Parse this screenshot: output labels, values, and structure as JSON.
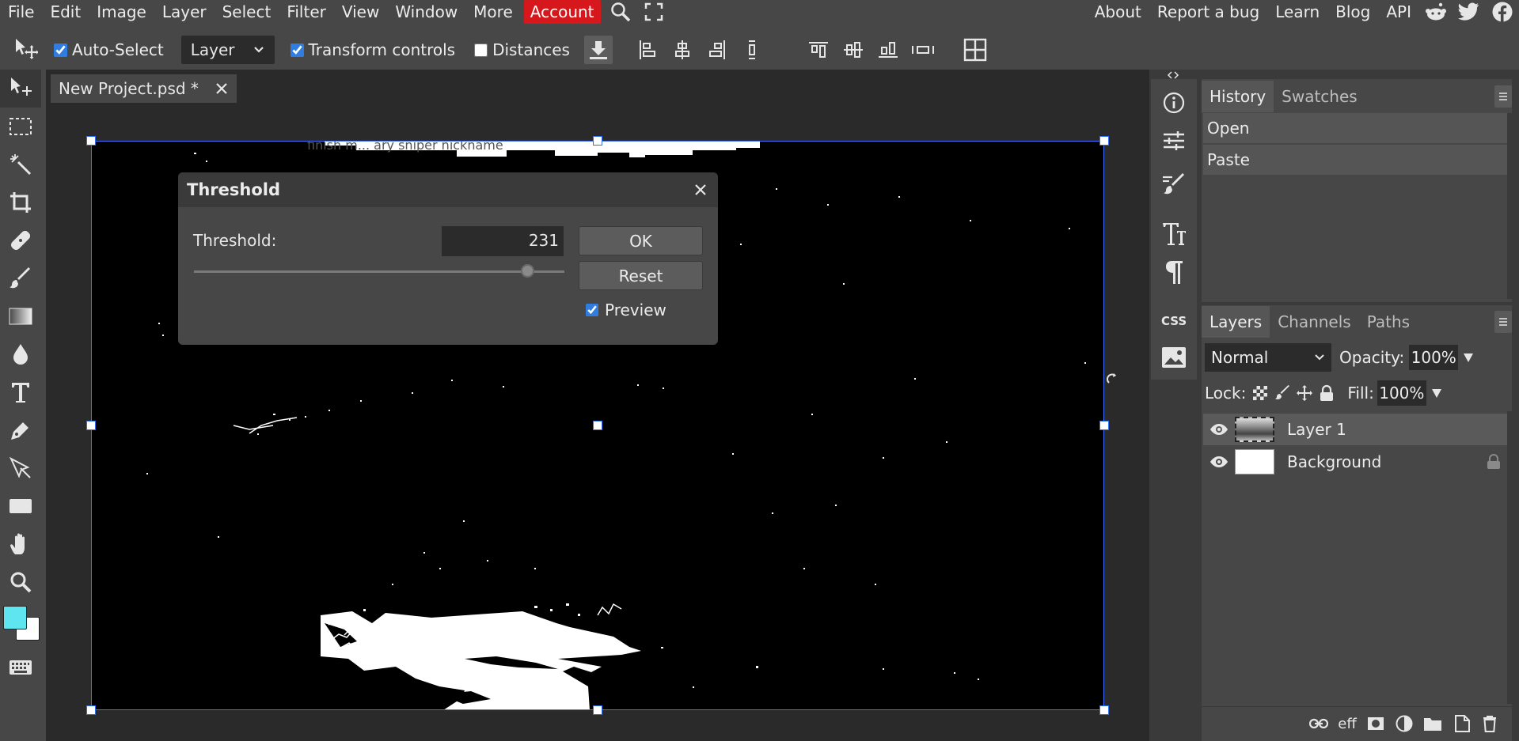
{
  "menu": {
    "items": [
      "File",
      "Edit",
      "Image",
      "Layer",
      "Select",
      "Filter",
      "View",
      "Window",
      "More"
    ],
    "account": "Account",
    "right_links": [
      "About",
      "Report a bug",
      "Learn",
      "Blog",
      "API"
    ],
    "social_icons": [
      "reddit-icon",
      "twitter-icon",
      "facebook-icon"
    ]
  },
  "toolbar": {
    "auto_select_label": "Auto-Select",
    "auto_select_checked": true,
    "target_select": "Layer",
    "transform_label": "Transform controls",
    "transform_checked": true,
    "distances_label": "Distances",
    "distances_checked": false
  },
  "document": {
    "tab_title": "New Project.psd *",
    "canvas_overlay_text": "finish m... ary sniper nickname"
  },
  "threshold_dialog": {
    "title": "Threshold",
    "label": "Threshold:",
    "value": "231",
    "slider_level": 0.9,
    "ok_label": "OK",
    "reset_label": "Reset",
    "preview_label": "Preview",
    "preview_checked": true
  },
  "history_panel": {
    "tabs": [
      "History",
      "Swatches"
    ],
    "active_tab": "History",
    "entries": [
      "Open",
      "Paste"
    ]
  },
  "layers_panel": {
    "tabs": [
      "Layers",
      "Channels",
      "Paths"
    ],
    "active_tab": "Layers",
    "blend_mode": "Normal",
    "opacity_label": "Opacity:",
    "opacity_value": "100%",
    "lock_label": "Lock:",
    "fill_label": "Fill:",
    "fill_value": "100%",
    "layers": [
      {
        "name": "Layer 1",
        "selected": true,
        "locked": false
      },
      {
        "name": "Background",
        "selected": false,
        "locked": true
      }
    ],
    "bottom_text": "eff"
  },
  "colors": {
    "accent": "#d6181c",
    "foreground_swatch": "#5ee5f0",
    "background_swatch": "#ffffff"
  }
}
